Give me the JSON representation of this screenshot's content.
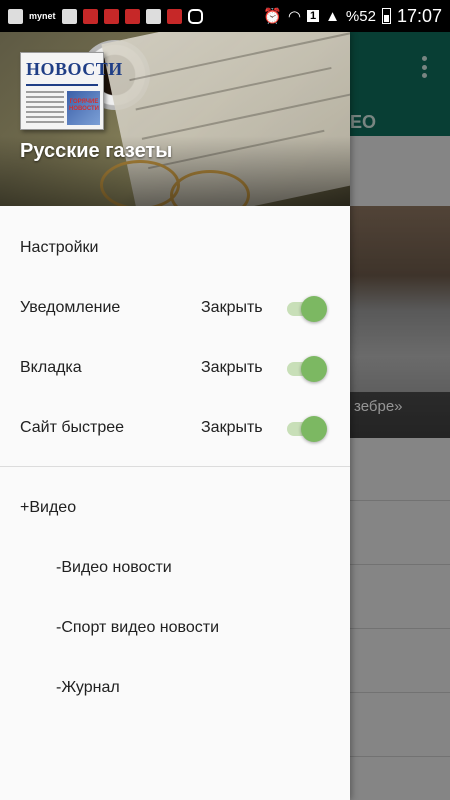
{
  "status_bar": {
    "left_icons": [
      "g-icon",
      "mnet-icon",
      "image-icon",
      "signal-app-icon",
      "news-app-icon",
      "news-app-icon-2",
      "fire-icon",
      "news-app-icon-3",
      "instagram-icon"
    ],
    "mnet_label": "mynet",
    "right_icons": [
      "alarm-icon",
      "wifi-icon",
      "sim1-icon",
      "signal-icon"
    ],
    "sim_label": "1",
    "battery": "%52",
    "time": "17:07"
  },
  "background": {
    "tab_fragment": "ЕО",
    "caption_fragment": "зебре»"
  },
  "drawer": {
    "logo_title": "НОВОСТИ",
    "logo_subtitle": "ГОРЯЧИЕ НОВОСТИ",
    "app_name": "Русские газеты",
    "settings_heading": "Настройки",
    "toggles": [
      {
        "label": "Уведомление",
        "action": "Закрыть",
        "on": true
      },
      {
        "label": "Вкладка",
        "action": "Закрыть",
        "on": true
      },
      {
        "label": "Сайт быстрее",
        "action": "Закрыть",
        "on": true
      }
    ],
    "video_heading": "+Видео",
    "video_items": [
      "-Видео новости",
      "-Спорт видео новости",
      "-Журнал"
    ]
  },
  "colors": {
    "toolbar": "#0f6b5a",
    "switch_thumb": "#7cb862",
    "switch_track": "#c8dfb8"
  }
}
